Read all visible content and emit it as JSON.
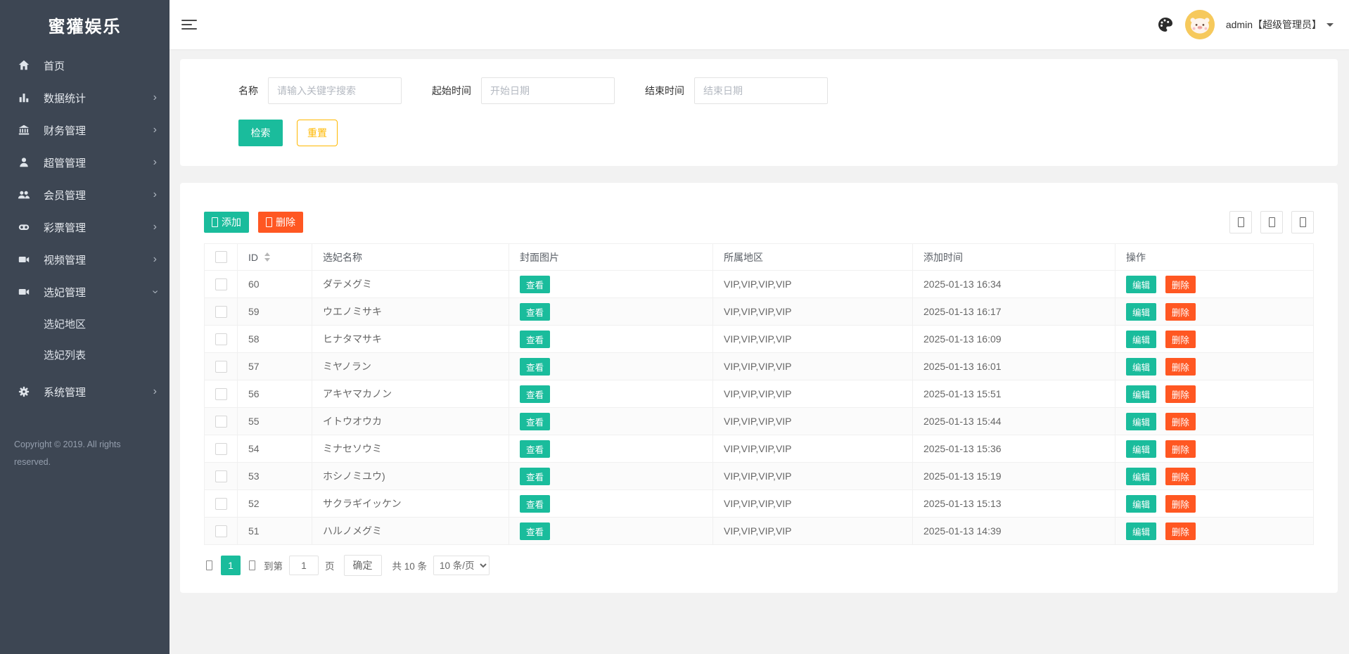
{
  "colors": {
    "accent_teal": "#1abc9c",
    "danger_orange": "#ff5722",
    "warning_yellow": "#ffb800",
    "sidebar_bg": "#3d4653",
    "avatar_bg": "#f6c95c"
  },
  "sidebar": {
    "logo": "蜜獾娱乐",
    "items": [
      {
        "label": "首页",
        "icon": "home-icon"
      },
      {
        "label": "数据统计",
        "icon": "bar-chart-icon"
      },
      {
        "label": "财务管理",
        "icon": "bank-icon"
      },
      {
        "label": "超管管理",
        "icon": "user-icon"
      },
      {
        "label": "会员管理",
        "icon": "users-icon"
      },
      {
        "label": "彩票管理",
        "icon": "gamepad-icon"
      },
      {
        "label": "视频管理",
        "icon": "video-icon"
      },
      {
        "label": "选妃管理",
        "icon": "video-icon"
      },
      {
        "label": "系统管理",
        "icon": "gear-icon"
      }
    ],
    "submenu": [
      {
        "label": "选妃地区"
      },
      {
        "label": "选妃列表"
      }
    ],
    "copyright": "Copyright © 2019. All rights reserved."
  },
  "topbar": {
    "admin_label": "admin【超级管理员】",
    "icons": [
      "hamburger-icon",
      "palette-icon",
      "avatar",
      "caret-down-icon"
    ]
  },
  "search_panel": {
    "name_label": "名称",
    "name_placeholder": "请输入关键字搜索",
    "start_label": "起始时间",
    "start_placeholder": "开始日期",
    "end_label": "结束时间",
    "end_placeholder": "结束日期",
    "search_btn": "检索",
    "reset_btn": "重置"
  },
  "table_panel": {
    "add_btn": "添加",
    "delete_btn": "删除",
    "columns": {
      "id": "ID",
      "name": "选妃名称",
      "cover": "封面图片",
      "region": "所属地区",
      "time": "添加时间",
      "ops": "操作"
    },
    "view_btn": "查看",
    "edit_btn": "编辑",
    "row_delete_btn": "删除",
    "rows": [
      {
        "id": "60",
        "name": "ダテメグミ",
        "region": "VIP,VIP,VIP,VIP",
        "time": "2025-01-13 16:34"
      },
      {
        "id": "59",
        "name": "ウエノミサキ",
        "region": "VIP,VIP,VIP,VIP",
        "time": "2025-01-13 16:17"
      },
      {
        "id": "58",
        "name": "ヒナタマサキ",
        "region": "VIP,VIP,VIP,VIP",
        "time": "2025-01-13 16:09"
      },
      {
        "id": "57",
        "name": "ミヤノラン",
        "region": "VIP,VIP,VIP,VIP",
        "time": "2025-01-13 16:01"
      },
      {
        "id": "56",
        "name": "アキヤマカノン",
        "region": "VIP,VIP,VIP,VIP",
        "time": "2025-01-13 15:51"
      },
      {
        "id": "55",
        "name": "イトウオウカ",
        "region": "VIP,VIP,VIP,VIP",
        "time": "2025-01-13 15:44"
      },
      {
        "id": "54",
        "name": "ミナセソウミ",
        "region": "VIP,VIP,VIP,VIP",
        "time": "2025-01-13 15:36"
      },
      {
        "id": "53",
        "name": "ホシノミユウ)",
        "region": "VIP,VIP,VIP,VIP",
        "time": "2025-01-13 15:19"
      },
      {
        "id": "52",
        "name": "サクラギイッケン",
        "region": "VIP,VIP,VIP,VIP",
        "time": "2025-01-13 15:13"
      },
      {
        "id": "51",
        "name": "ハルノメグミ",
        "region": "VIP,VIP,VIP,VIP",
        "time": "2025-01-13 14:39"
      }
    ]
  },
  "pagination": {
    "current_page": "1",
    "goto_label": "到第",
    "page_input": "1",
    "page_suffix": "页",
    "confirm_btn": "确定",
    "total_label": "共 10 条",
    "page_size": "10 条/页"
  }
}
